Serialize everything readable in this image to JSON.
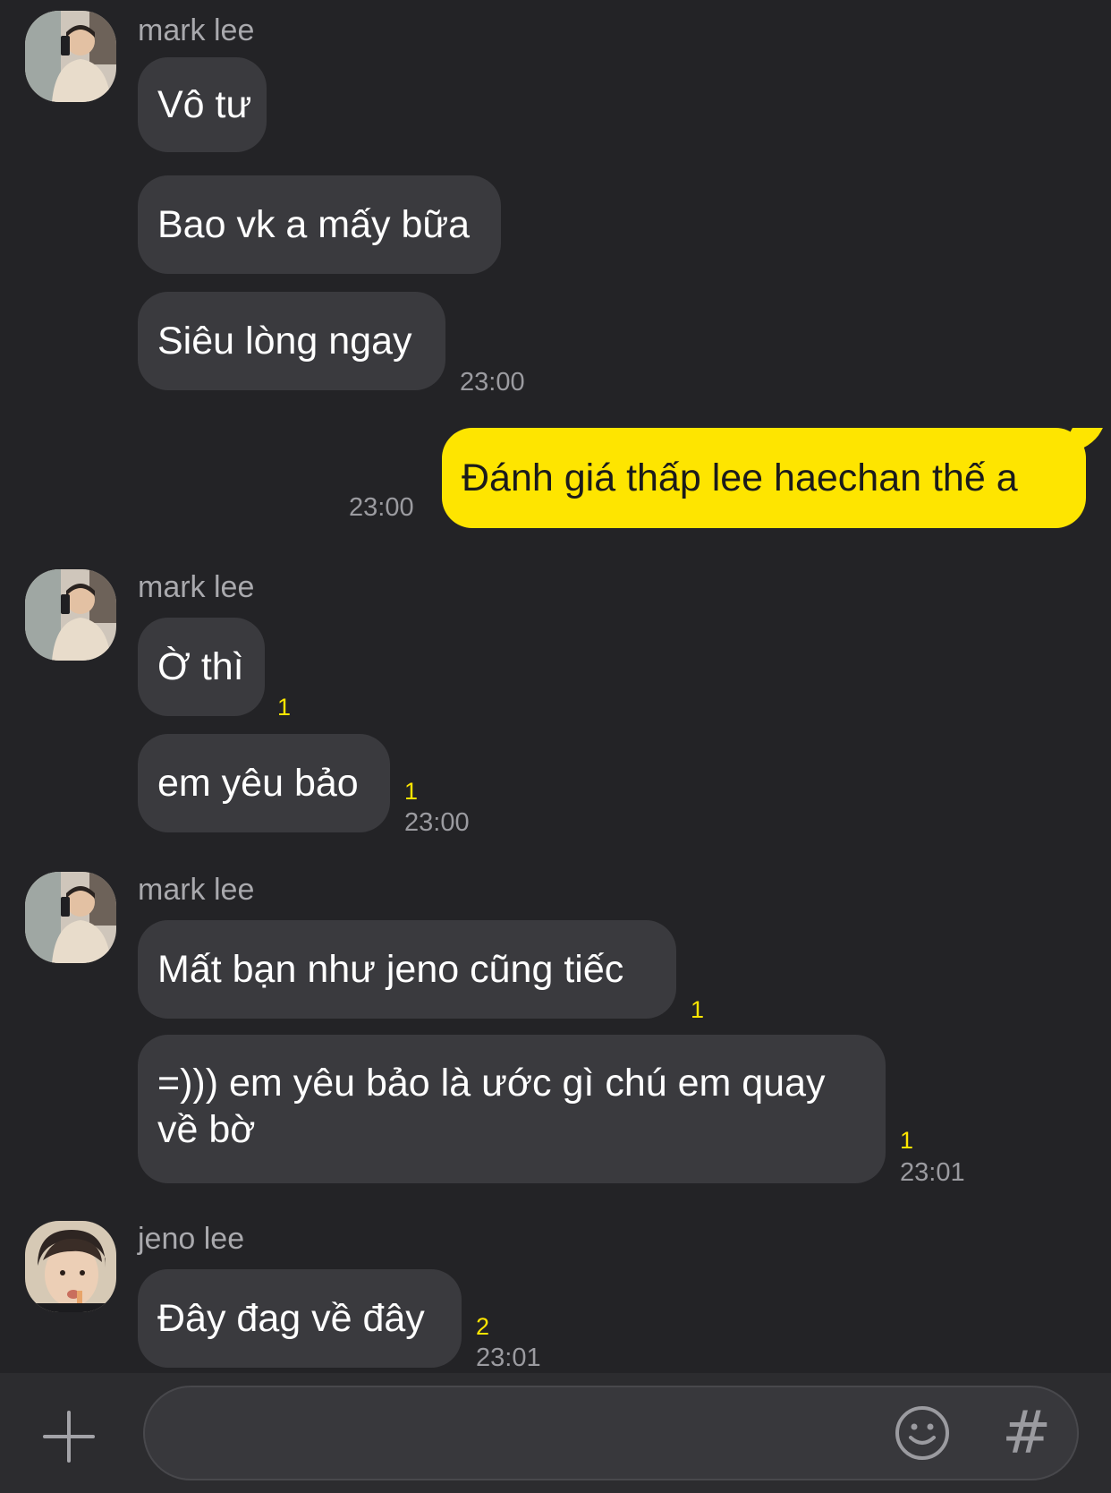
{
  "colors": {
    "background": "#232326",
    "incoming_bubble": "#3a3a3e",
    "outgoing_bubble": "#fee500",
    "unread_count": "#fee500",
    "timestamp": "#9b9ba0"
  },
  "messages": {
    "group1": {
      "sender": "mark lee",
      "m1": "Vô tư",
      "m2": "Bao vk a mấy bữa",
      "m3": "Siêu lòng ngay",
      "time": "23:00"
    },
    "outgoing": {
      "text": "Đánh giá thấp lee haechan thế a",
      "time": "23:00"
    },
    "group2": {
      "sender": "mark lee",
      "m1": "Ờ thì",
      "m1_unread": "1",
      "m2": "em yêu bảo",
      "m2_unread": "1",
      "time": "23:00"
    },
    "group3": {
      "sender": "mark lee",
      "m1": "Mất bạn như jeno cũng tiếc",
      "m1_unread": "1",
      "m2": "=))) em yêu bảo là ước gì chú em quay về bờ",
      "m2_unread": "1",
      "time": "23:01"
    },
    "group4": {
      "sender": "jeno lee",
      "m1": "Đây đag về đây",
      "m1_unread": "2",
      "time": "23:01"
    }
  },
  "input_bar": {
    "plus_icon": "plus-icon",
    "message_value": "",
    "emoji_icon": "smiley-icon",
    "hash_label": "#"
  }
}
